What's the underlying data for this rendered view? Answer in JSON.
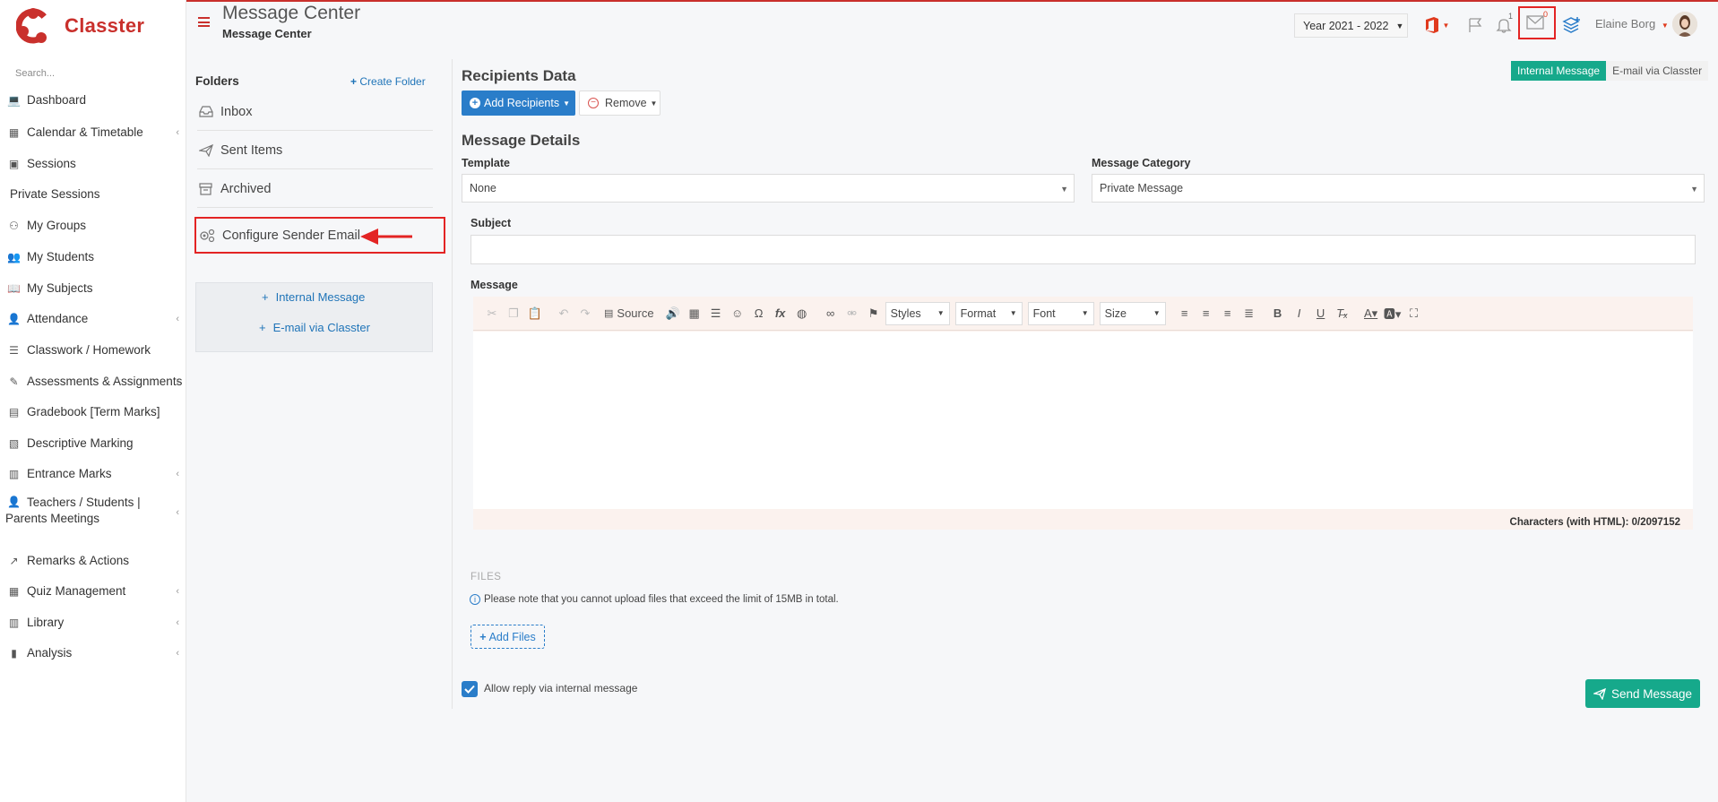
{
  "app": {
    "name": "Classter",
    "search_placeholder": "Search..."
  },
  "sidebar": {
    "items": [
      {
        "label": "Dashboard",
        "icon": "laptop-icon",
        "chevron": false
      },
      {
        "label": "Calendar & Timetable",
        "icon": "calendar-icon",
        "chevron": true
      },
      {
        "label": "Sessions",
        "icon": "sessions-icon",
        "chevron": false
      },
      {
        "label": "Private Sessions",
        "icon": "",
        "chevron": false
      },
      {
        "label": "My Groups",
        "icon": "groups-icon",
        "chevron": false
      },
      {
        "label": "My Students",
        "icon": "students-icon",
        "chevron": false
      },
      {
        "label": "My Subjects",
        "icon": "book-icon",
        "chevron": false
      },
      {
        "label": "Attendance",
        "icon": "attendance-icon",
        "chevron": true
      },
      {
        "label": "Classwork / Homework",
        "icon": "list-icon",
        "chevron": false
      },
      {
        "label": "Assessments & Assignments",
        "icon": "edit-icon",
        "chevron": true
      },
      {
        "label": "Gradebook [Term Marks]",
        "icon": "gradebook-icon",
        "chevron": false
      },
      {
        "label": "Descriptive Marking",
        "icon": "marking-icon",
        "chevron": false
      },
      {
        "label": "Entrance Marks",
        "icon": "clipboard-icon",
        "chevron": true
      },
      {
        "label": "Teachers / Students |",
        "label2": "Parents Meetings",
        "icon": "meeting-icon",
        "chevron": true
      },
      {
        "label": "Remarks & Actions",
        "icon": "remarks-icon",
        "chevron": false
      },
      {
        "label": "Quiz Management",
        "icon": "quiz-icon",
        "chevron": true
      },
      {
        "label": "Library",
        "icon": "library-icon",
        "chevron": true
      },
      {
        "label": "Analysis",
        "icon": "chart-icon",
        "chevron": true
      }
    ]
  },
  "header": {
    "title": "Message Center",
    "subtitle": "Message Center",
    "year": "Year 2021 - 2022",
    "notifications_count": "1",
    "messages_count": "0",
    "user_name": "Elaine Borg"
  },
  "folders": {
    "heading": "Folders",
    "create_label": "Create Folder",
    "items": [
      {
        "label": "Inbox",
        "icon": "inbox-icon"
      },
      {
        "label": "Sent Items",
        "icon": "send-icon"
      },
      {
        "label": "Archived",
        "icon": "archive-icon"
      }
    ],
    "configure_label": "Configure Sender Email",
    "new_internal": "Internal Message",
    "new_email": "E-mail via Classter"
  },
  "recipients": {
    "heading": "Recipients Data",
    "add_label": "Add Recipients",
    "remove_label": "Remove",
    "tab_internal": "Internal Message",
    "tab_email": "E-mail via Classter"
  },
  "details": {
    "heading": "Message Details",
    "template_label": "Template",
    "template_value": "None",
    "category_label": "Message Category",
    "category_value": "Private Message",
    "subject_label": "Subject",
    "subject_value": "",
    "message_label": "Message"
  },
  "editor": {
    "source": "Source",
    "styles": "Styles",
    "format": "Format",
    "font": "Font",
    "size": "Size",
    "char_count": "Characters (with HTML): 0/2097152"
  },
  "files": {
    "heading": "FILES",
    "note": "Please note that you cannot upload files that exceed the limit of 15MB in total.",
    "add_label": "Add Files"
  },
  "footer": {
    "allow_reply_label": "Allow reply via internal message",
    "allow_reply_checked": true,
    "send_label": "Send Message"
  },
  "colors": {
    "brand": "#c9302c",
    "primary": "#2a7dc9",
    "success": "#16a98b",
    "highlight": "#e32424"
  }
}
